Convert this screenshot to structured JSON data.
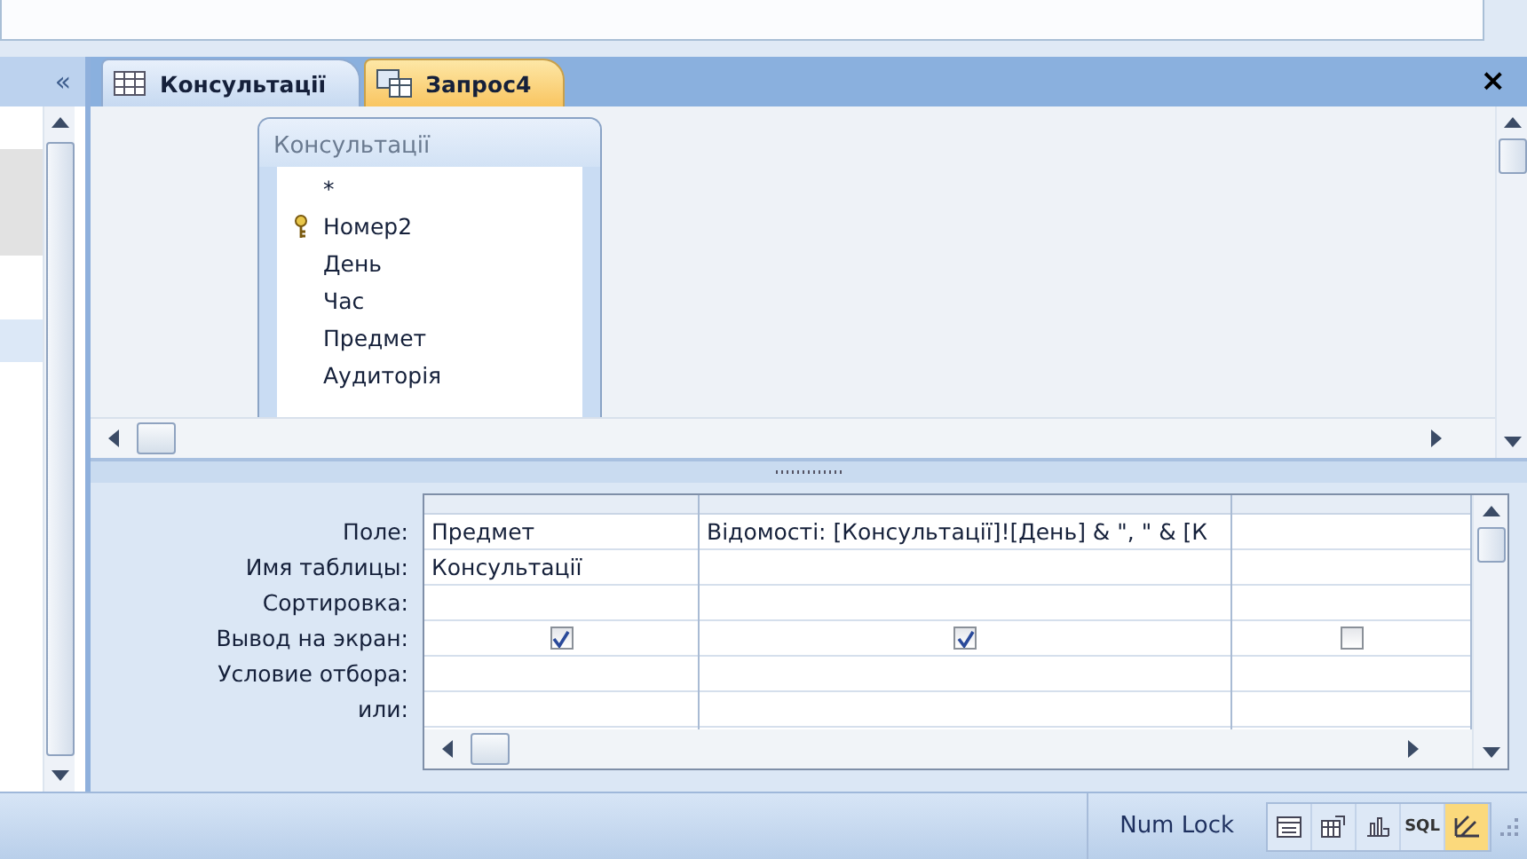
{
  "nav_pane": {
    "collapse_glyph": "«"
  },
  "tabs": [
    {
      "label": "Консультації",
      "kind": "table",
      "selected": false
    },
    {
      "label": "Запрос4",
      "kind": "query",
      "selected": true
    }
  ],
  "close_glyph": "×",
  "field_list": {
    "title": "Консультації",
    "fields": [
      {
        "name": "*",
        "key": false
      },
      {
        "name": "Номер2",
        "key": true
      },
      {
        "name": "День",
        "key": false
      },
      {
        "name": "Час",
        "key": false
      },
      {
        "name": "Предмет",
        "key": false
      },
      {
        "name": "Аудиторія",
        "key": false
      }
    ]
  },
  "grid": {
    "row_labels": [
      "Поле:",
      "Имя таблицы:",
      "Сортировка:",
      "Вывод на экран:",
      "Условие отбора:",
      "или:"
    ],
    "columns": [
      {
        "field": "Предмет",
        "table": "Консультації",
        "show": true
      },
      {
        "field": "Відомості: [Консультації]![День] & \", \" & [К",
        "show": true
      },
      {
        "show": false
      }
    ]
  },
  "status_bar": {
    "text": "Num Lock",
    "views": [
      {
        "kind": "datasheet",
        "selected": false
      },
      {
        "kind": "pivot-table",
        "selected": false
      },
      {
        "kind": "pivot-chart",
        "selected": false
      },
      {
        "kind": "sql",
        "label": "SQL",
        "selected": false
      },
      {
        "kind": "design",
        "selected": true
      }
    ]
  }
}
